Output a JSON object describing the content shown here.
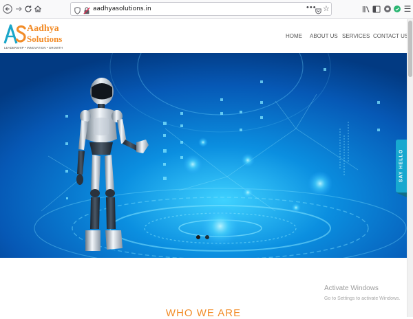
{
  "browser": {
    "url": "aadhyasolutions.in",
    "icons": {
      "back": "back-arrow-icon",
      "forward": "forward-arrow-icon",
      "reload": "reload-icon",
      "home": "home-icon",
      "page_actions": "more-dots-icon",
      "pocket": "pocket-icon",
      "bookmark": "bookmark-star-icon",
      "library": "library-icon",
      "sidebar": "sidebar-icon",
      "extension_1": "extension-icon",
      "extension_2": "extension-icon",
      "menu": "hamburger-menu-icon"
    },
    "page_actions_glyph": "•••",
    "star_glyph": "☆",
    "menu_glyph": "☰"
  },
  "site": {
    "logo": {
      "monogram": "AS",
      "name_line1": "Aadhya",
      "name_line2": "Solutions",
      "tagline": "LEADERSHIP • INNOVATION • GROWTH"
    },
    "nav": [
      {
        "label": "HOME"
      },
      {
        "label": "ABOUT US"
      },
      {
        "label": "SERVICES"
      },
      {
        "label": "CONTACT US"
      }
    ],
    "hero": {
      "slides_total": 2,
      "active_slide": 1
    },
    "say_hello": "SAY HELLO",
    "section_title": "WHO WE ARE"
  },
  "os_overlay": {
    "title": "Activate Windows",
    "subtitle": "Go to Settings to activate Windows."
  },
  "colors": {
    "brand_orange": "#f28c28",
    "brand_teal": "#1aa6c9",
    "hero_blue": "#0a67bd",
    "say_hello_bg": "#17a8cf"
  }
}
